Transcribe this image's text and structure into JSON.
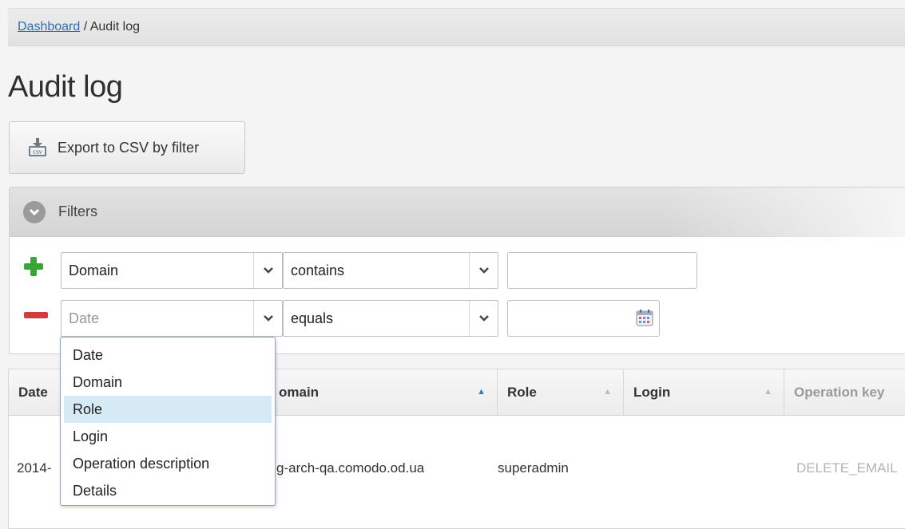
{
  "breadcrumb": {
    "link": "Dashboard",
    "separator": " / ",
    "current": "Audit log"
  },
  "page": {
    "title": "Audit log"
  },
  "toolbar": {
    "export_label": "Export to CSV by filter"
  },
  "filters": {
    "header_label": "Filters",
    "rows": [
      {
        "field": "Domain",
        "operator": "contains",
        "value": ""
      },
      {
        "field_placeholder": "Date",
        "operator": "equals",
        "value": ""
      }
    ]
  },
  "dropdown": {
    "options": [
      "Date",
      "Domain",
      "Role",
      "Login",
      "Operation description",
      "Details"
    ],
    "highlighted": "Role"
  },
  "table": {
    "columns": [
      "Date",
      "Domain",
      "Role",
      "Login",
      "Operation key"
    ],
    "visible_header_text": [
      "Date",
      "omain",
      "Role",
      "Login",
      "Operation key"
    ],
    "row": {
      "date": "2014-",
      "domain": "g-arch-qa.comodo.od.ua",
      "role": "superadmin",
      "login": "",
      "operation_key": "DELETE_EMAIL"
    }
  },
  "colors": {
    "accent": "#2a6ebb",
    "add": "#3aa33a",
    "remove": "#d13b3b",
    "highlight": "#d5eaf5"
  }
}
